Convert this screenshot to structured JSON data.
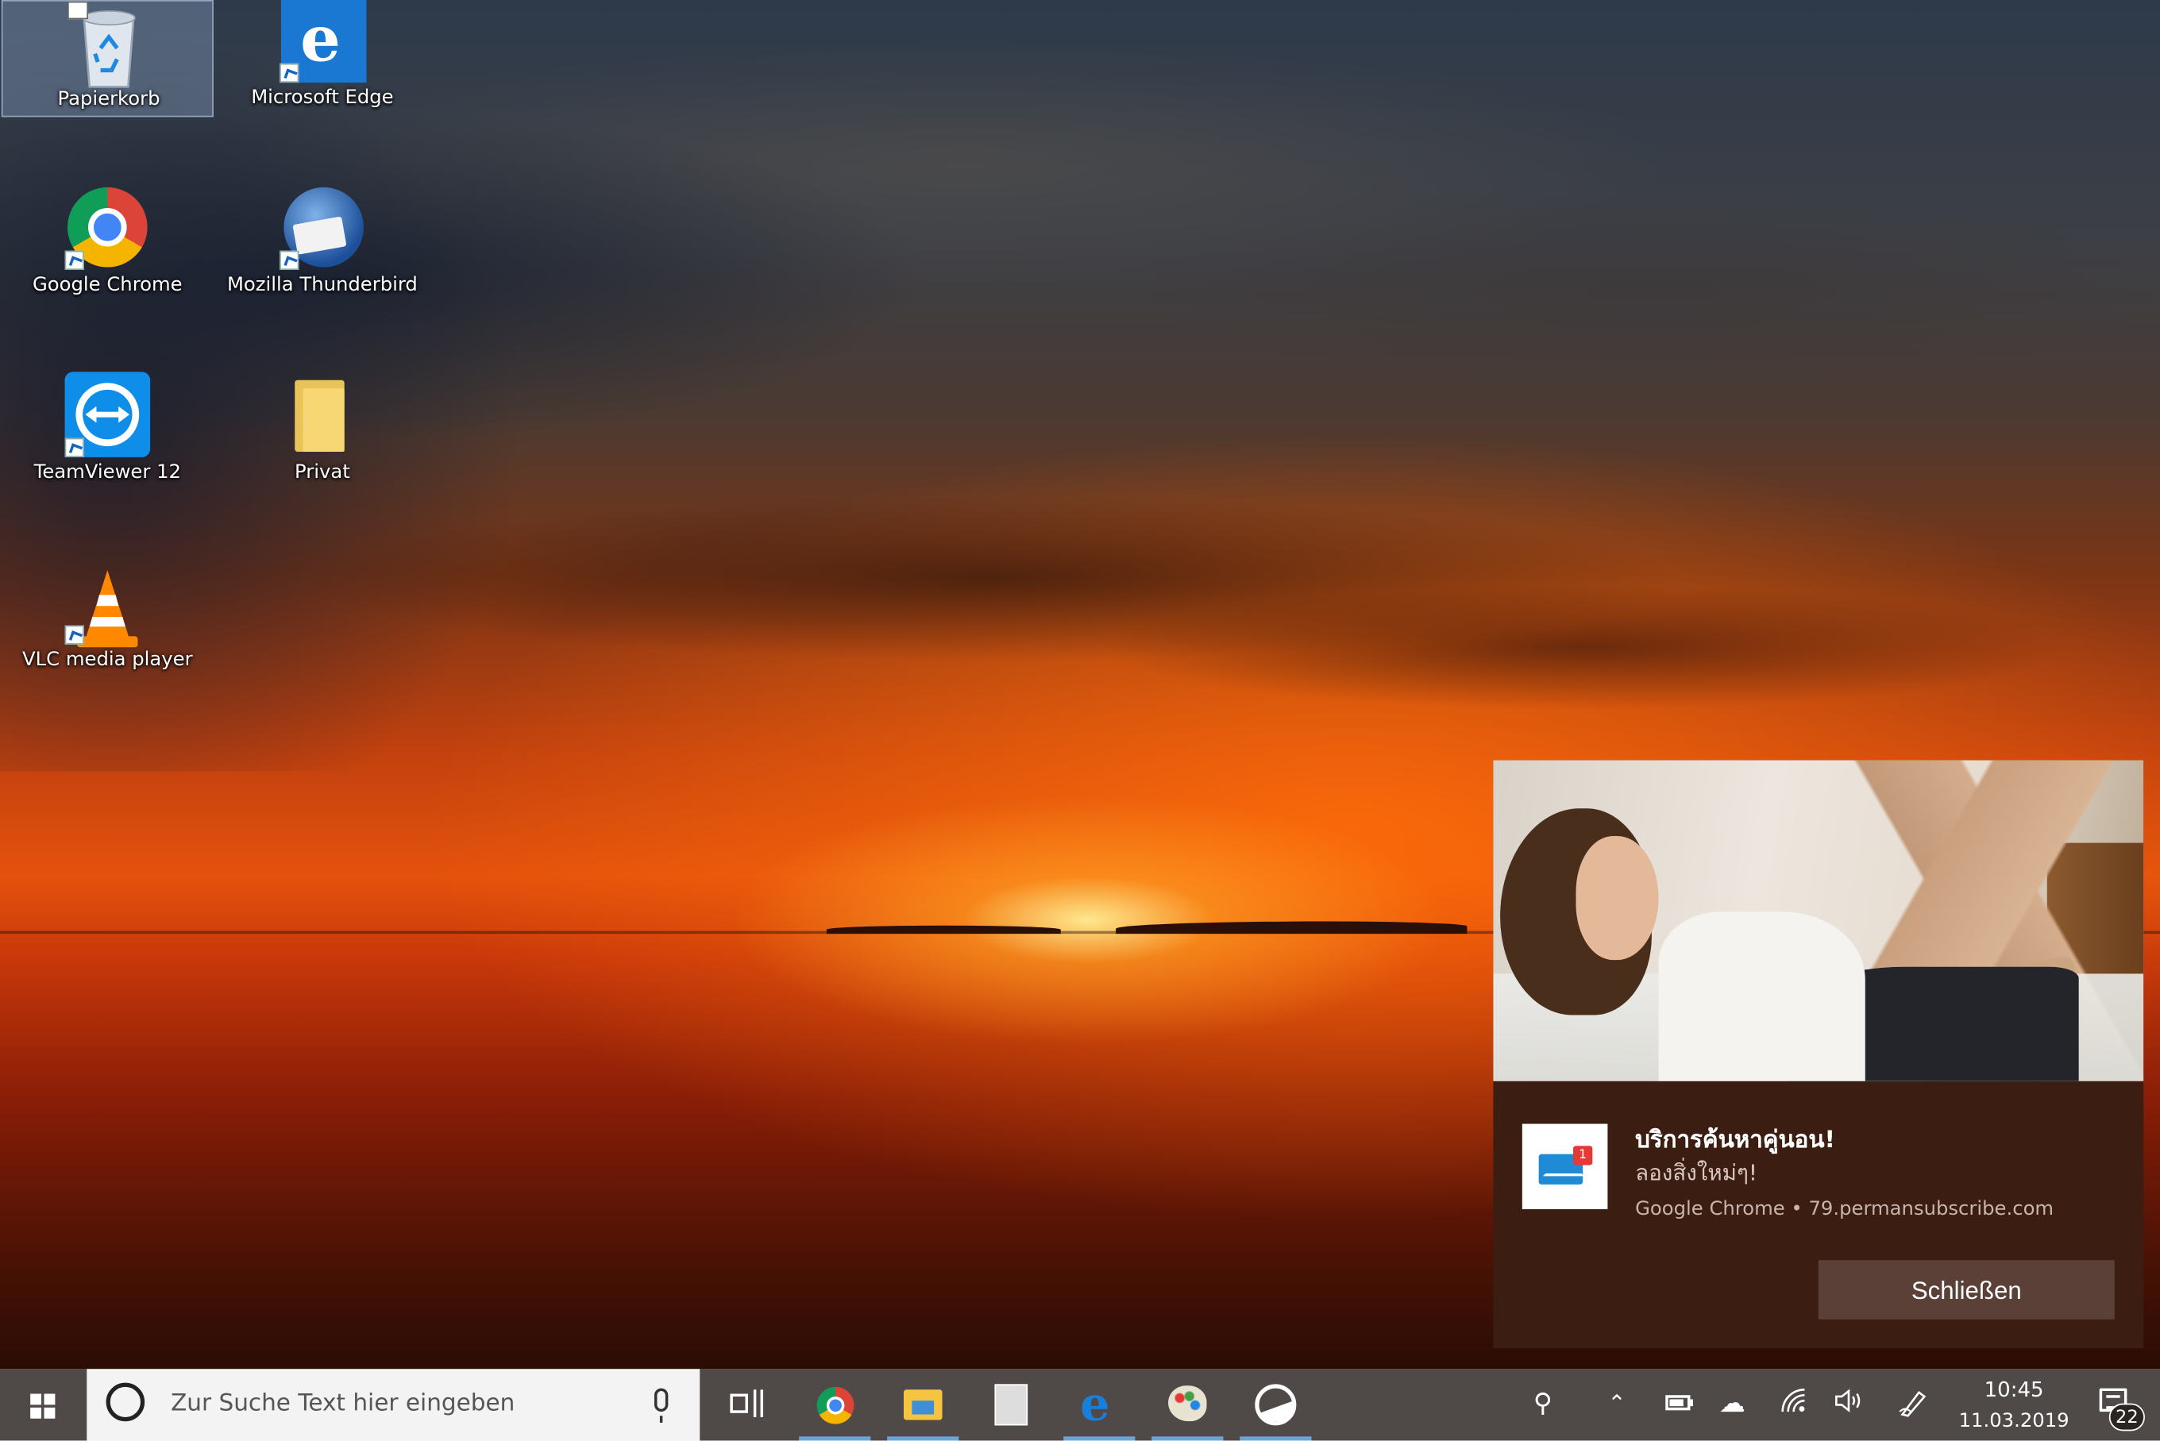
{
  "desktop": {
    "icons": [
      {
        "label": "Papierkorb",
        "icon": "recycle-bin-icon",
        "selected": true
      },
      {
        "label": "Microsoft Edge",
        "icon": "edge-icon"
      },
      {
        "label": "Google Chrome",
        "icon": "chrome-icon"
      },
      {
        "label": "Mozilla Thunderbird",
        "icon": "thunderbird-icon"
      },
      {
        "label": "TeamViewer 12",
        "icon": "teamviewer-icon"
      },
      {
        "label": "Privat",
        "icon": "folder-icon"
      },
      {
        "label": "VLC media player",
        "icon": "vlc-icon"
      }
    ]
  },
  "notification": {
    "title": "บริการค้นหาคู่นอน!",
    "body": "ลองสิ่งใหม่ๆ!",
    "source": "Google Chrome • 79.permansubscribe.com",
    "badge_count": "1",
    "close_label": "Schließen"
  },
  "taskbar": {
    "search_placeholder": "Zur Suche Text hier eingeben",
    "pinned": [
      "task-view",
      "chrome",
      "file-explorer",
      "calculator",
      "edge",
      "paint",
      "photos"
    ],
    "clock_time": "10:45",
    "clock_date": "11.03.2019",
    "notification_count": "22"
  },
  "colors": {
    "toast_bg": "#3b1d12",
    "toast_button": "#5b4038",
    "taskbar_bg": "#28211e",
    "accent_underline": "#6ea3d8"
  }
}
